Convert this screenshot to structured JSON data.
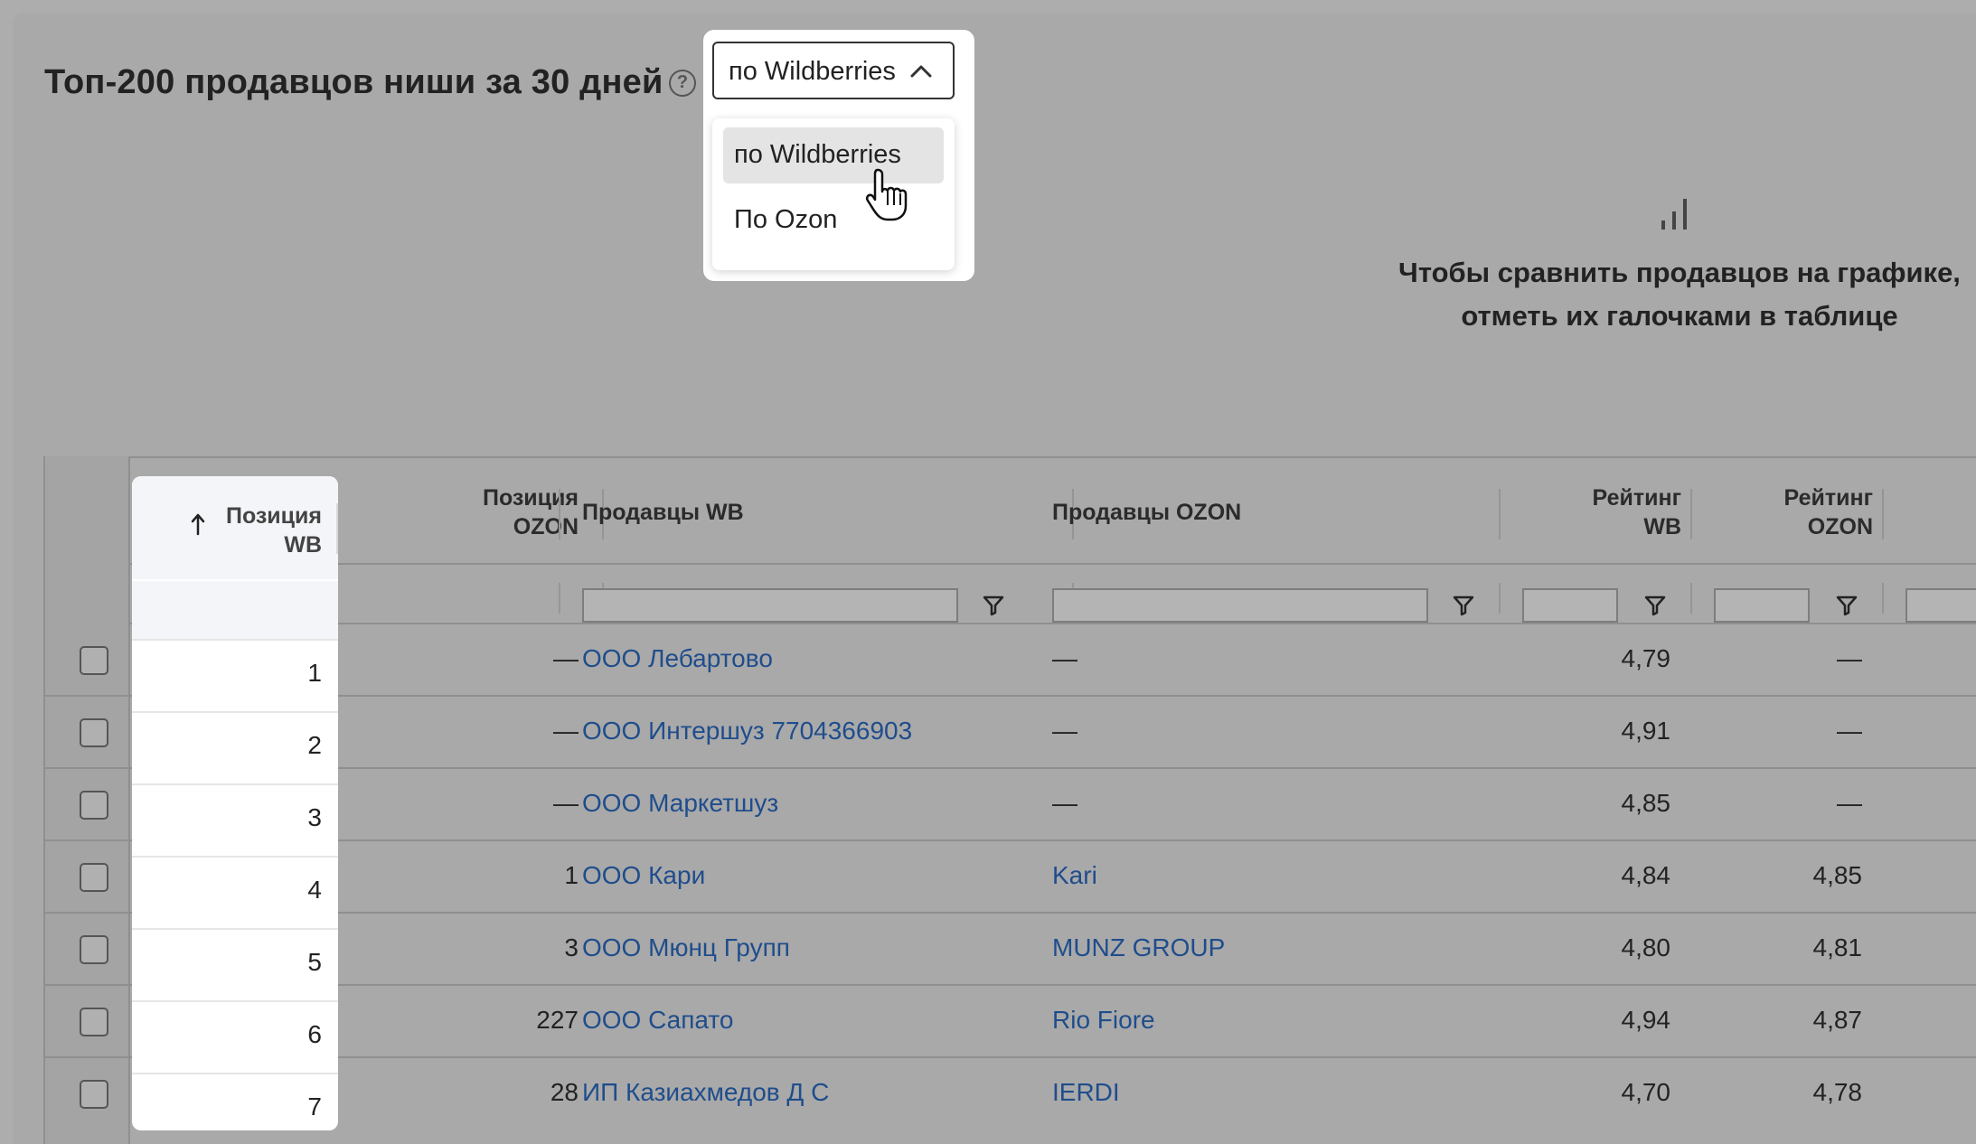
{
  "title": "Топ-200 продавцов ниши за 30 дней",
  "help_icon": "question-circle-icon",
  "marketplace_select": {
    "value": "по Wildberries",
    "options": [
      "по Wildberries",
      "По Ozon"
    ]
  },
  "chart_hint": {
    "icon": "bar-chart-icon",
    "line1": "Чтобы сравнить продавцов на графике,",
    "line2": "отметь их галочками в таблице"
  },
  "table": {
    "columns": {
      "pos_wb_1": "Позиция",
      "pos_wb_2": "WB",
      "pos_ozon_1": "Позиция",
      "pos_ozon_2": "OZON",
      "sellers_wb": "Продавцы WB",
      "sellers_ozon": "Продавцы OZON",
      "rating_wb_1": "Рейтинг",
      "rating_wb_2": "WB",
      "rating_ozon_1": "Рейтинг",
      "rating_ozon_2": "OZON"
    },
    "sort_icon": "arrow-up-icon",
    "filter_icon": "filter-funnel-icon",
    "rows": [
      {
        "pos_wb": "1",
        "pos_ozon": "—",
        "seller_wb": "ООО Лебартово",
        "seller_ozon": "—",
        "rating_wb": "4,79",
        "rating_ozon": "—"
      },
      {
        "pos_wb": "2",
        "pos_ozon": "—",
        "seller_wb": "ООО Интершуз 7704366903",
        "seller_ozon": "—",
        "rating_wb": "4,91",
        "rating_ozon": "—"
      },
      {
        "pos_wb": "3",
        "pos_ozon": "—",
        "seller_wb": "ООО Маркетшуз",
        "seller_ozon": "—",
        "rating_wb": "4,85",
        "rating_ozon": "—"
      },
      {
        "pos_wb": "4",
        "pos_ozon": "1",
        "seller_wb": "ООО Кари",
        "seller_ozon": "Kari",
        "rating_wb": "4,84",
        "rating_ozon": "4,85"
      },
      {
        "pos_wb": "5",
        "pos_ozon": "3",
        "seller_wb": "ООО Мюнц Групп",
        "seller_ozon": "MUNZ GROUP",
        "rating_wb": "4,80",
        "rating_ozon": "4,81"
      },
      {
        "pos_wb": "6",
        "pos_ozon": "227",
        "seller_wb": "ООО Сапато",
        "seller_ozon": "Rio Fiore",
        "rating_wb": "4,94",
        "rating_ozon": "4,87"
      },
      {
        "pos_wb": "7",
        "pos_ozon": "28",
        "seller_wb": "ИП Казиахмедов Д С",
        "seller_ozon": "IERDI",
        "rating_wb": "4,70",
        "rating_ozon": "4,78"
      }
    ]
  }
}
